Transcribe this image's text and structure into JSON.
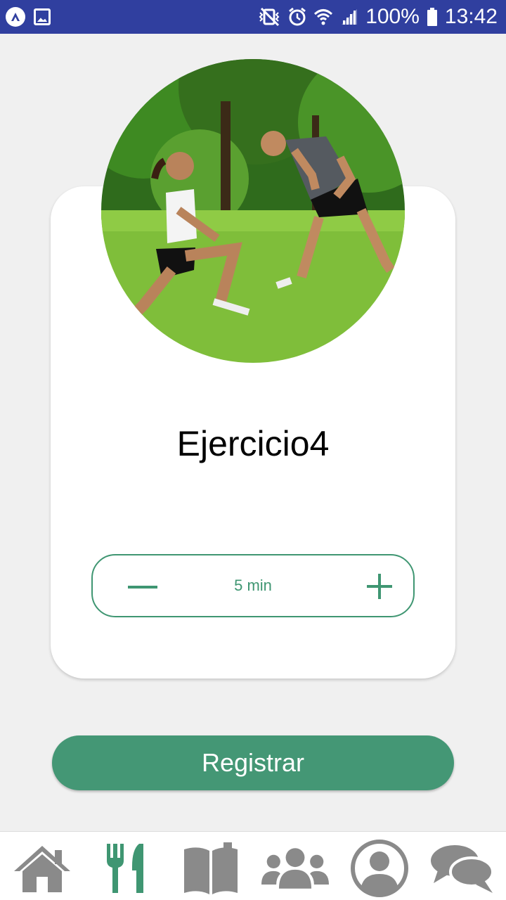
{
  "status_bar": {
    "battery": "100%",
    "time": "13:42"
  },
  "exercise": {
    "title": "Ejercicio4",
    "duration_value": "5 min"
  },
  "actions": {
    "register_label": "Registrar"
  },
  "bottom_nav": {
    "items": [
      {
        "icon": "home-icon",
        "active": false
      },
      {
        "icon": "utensils-icon",
        "active": true
      },
      {
        "icon": "book-icon",
        "active": false
      },
      {
        "icon": "users-icon",
        "active": false
      },
      {
        "icon": "profile-icon",
        "active": false
      },
      {
        "icon": "chat-icon",
        "active": false
      }
    ]
  },
  "colors": {
    "accent": "#449775",
    "status_bar": "#303f9f",
    "nav_inactive": "#8a8a8a",
    "nav_active": "#3f9672"
  }
}
